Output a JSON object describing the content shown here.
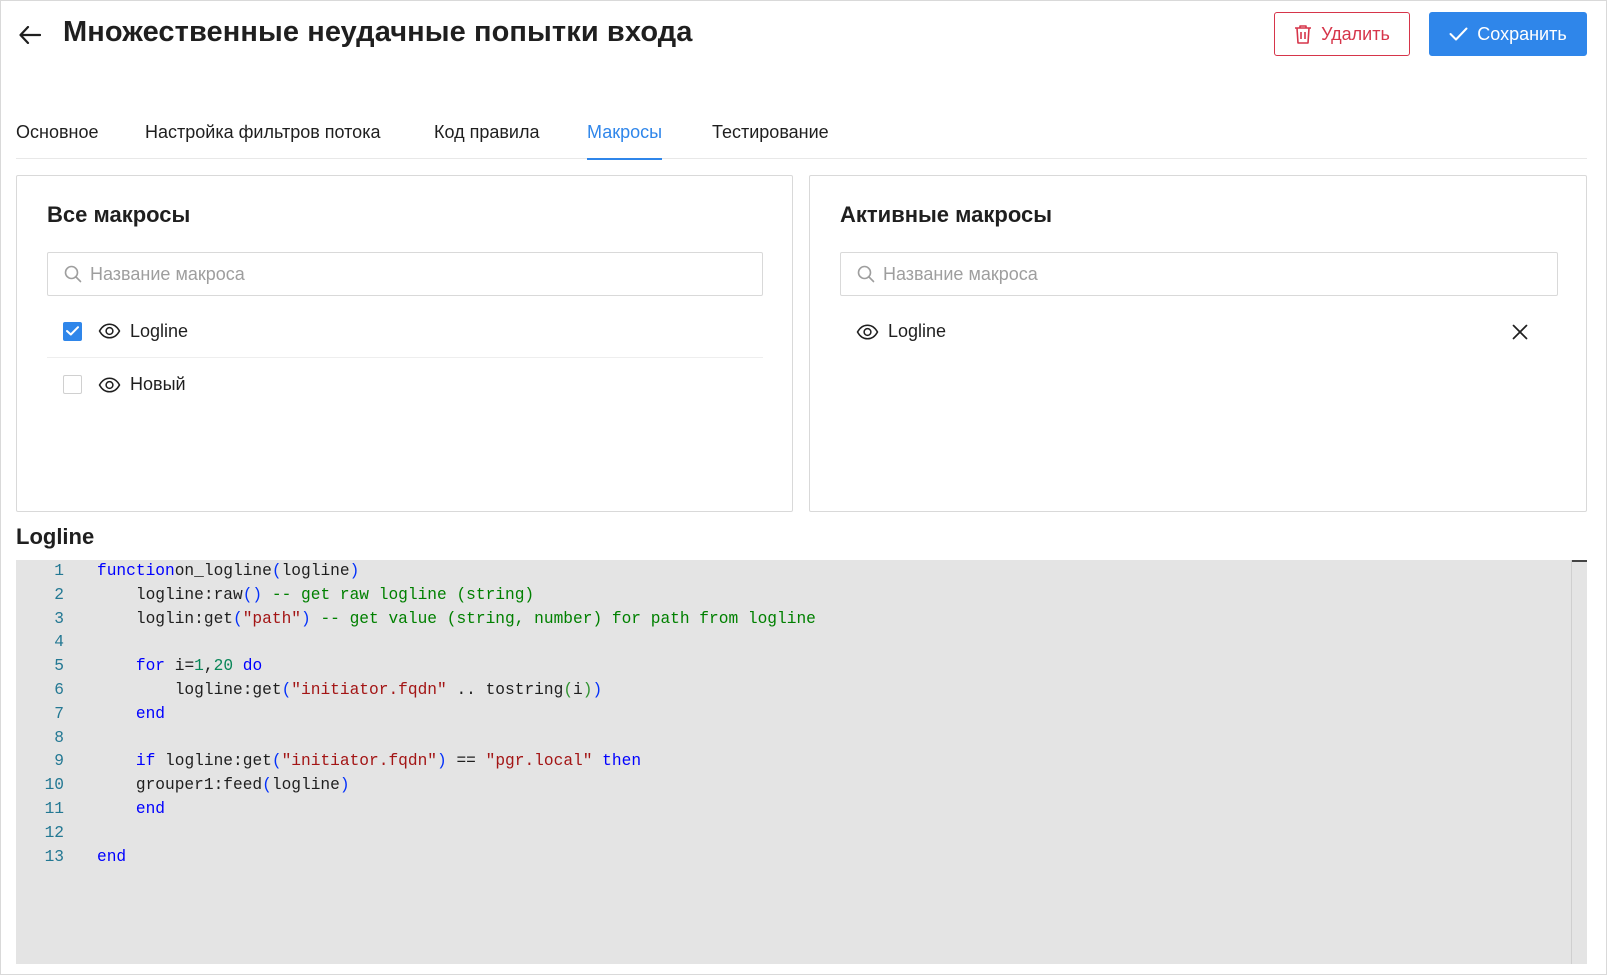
{
  "header": {
    "title": "Множественные неудачные попытки входа",
    "delete_label": "Удалить",
    "save_label": "Сохранить"
  },
  "tabs": [
    {
      "label": "Основное",
      "active": false
    },
    {
      "label": "Настройка фильтров потока",
      "active": false
    },
    {
      "label": "Код правила",
      "active": false
    },
    {
      "label": "Макросы",
      "active": true
    },
    {
      "label": "Тестирование",
      "active": false
    }
  ],
  "all_macros": {
    "title": "Все макросы",
    "search_placeholder": "Название макроса",
    "items": [
      {
        "name": "Logline",
        "checked": true
      },
      {
        "name": "Новый",
        "checked": false
      }
    ]
  },
  "active_macros": {
    "title": "Активные макросы",
    "search_placeholder": "Название макроса",
    "items": [
      {
        "name": "Logline"
      }
    ]
  },
  "editor": {
    "title": "Logline",
    "lines": [
      [
        [
          "kw",
          "function"
        ],
        [
          "",
          "on_logline"
        ],
        [
          "pb",
          "("
        ],
        [
          "",
          "logline"
        ],
        [
          "pb",
          ")"
        ]
      ],
      [
        [
          "",
          "    logline:raw"
        ],
        [
          "pb",
          "()"
        ],
        [
          "cmt",
          " -- get raw logline (string)"
        ]
      ],
      [
        [
          "",
          "    loglin:get"
        ],
        [
          "pb",
          "("
        ],
        [
          "str",
          "\"path\""
        ],
        [
          "pb",
          ")"
        ],
        [
          "cmt",
          " -- get value (string, number) for path from logline"
        ]
      ],
      [],
      [
        [
          "",
          "    "
        ],
        [
          "kw",
          "for"
        ],
        [
          "",
          " i="
        ],
        [
          "num",
          "1"
        ],
        [
          "",
          ","
        ],
        [
          "num",
          "20"
        ],
        [
          "",
          ""
        ],
        [
          "kw",
          " do"
        ]
      ],
      [
        [
          "",
          "        logline:get"
        ],
        [
          "pb",
          "("
        ],
        [
          "str",
          "\"initiator.fqdn\""
        ],
        [
          "",
          " .. tostring"
        ],
        [
          "pg",
          "("
        ],
        [
          "",
          "i"
        ],
        [
          "pg",
          ")"
        ],
        [
          "pb",
          ")"
        ]
      ],
      [
        [
          "",
          "    "
        ],
        [
          "kw",
          "end"
        ]
      ],
      [],
      [
        [
          "",
          "    "
        ],
        [
          "kw",
          "if"
        ],
        [
          "",
          " logline:get"
        ],
        [
          "pb",
          "("
        ],
        [
          "str",
          "\"initiator.fqdn\""
        ],
        [
          "pb",
          ")"
        ],
        [
          "",
          " == "
        ],
        [
          "str",
          "\"pgr.local\""
        ],
        [
          "kw",
          " then"
        ]
      ],
      [
        [
          "",
          "    grouper1:feed"
        ],
        [
          "pb",
          "("
        ],
        [
          "",
          "logline"
        ],
        [
          "pb",
          ")"
        ]
      ],
      [
        [
          "",
          "    "
        ],
        [
          "kw",
          "end"
        ]
      ],
      [],
      [
        [
          "kw",
          "end"
        ]
      ]
    ]
  },
  "colors": {
    "accent": "#2f86ea",
    "danger": "#d6354a",
    "editor_bg": "#e4e4e4"
  }
}
